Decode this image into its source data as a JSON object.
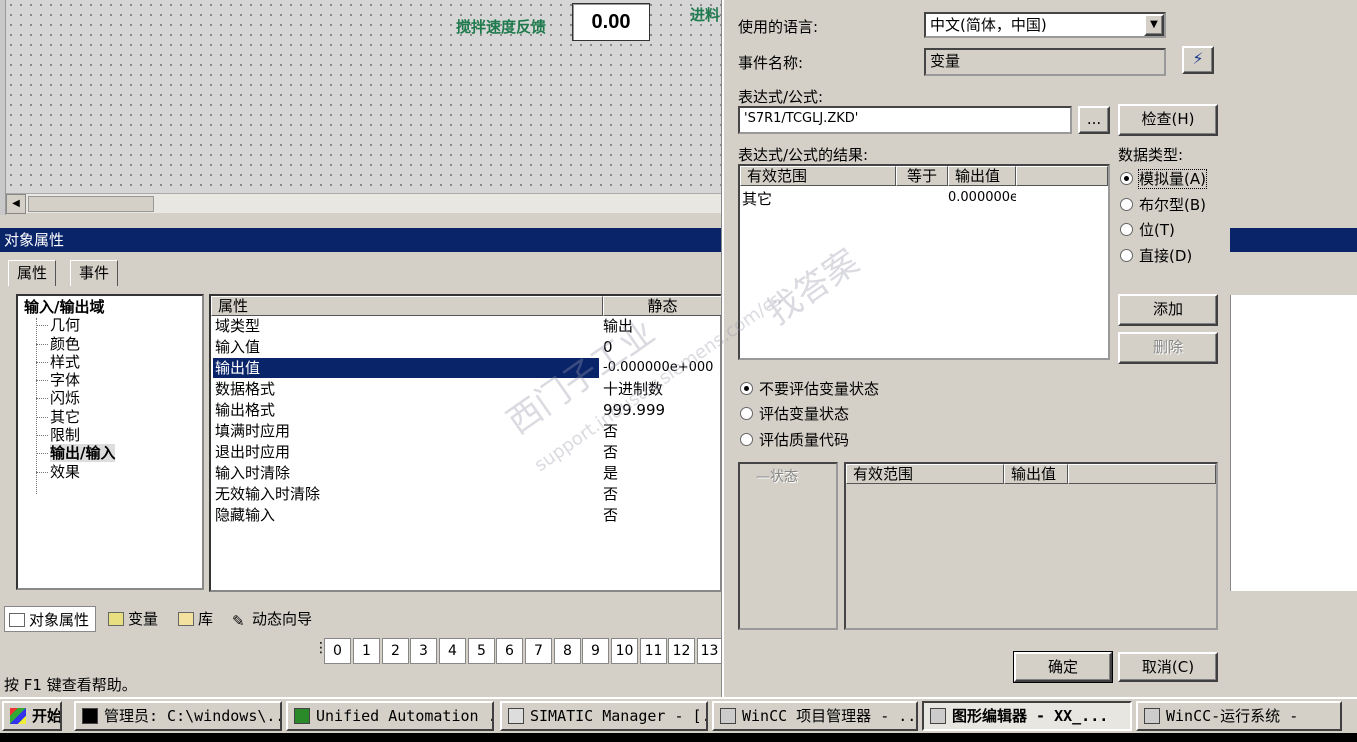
{
  "canvas": {
    "label_stir": "搅拌速度反馈",
    "field_value": "0.00",
    "label_feed": "进料"
  },
  "object_properties": {
    "title": "对象属性",
    "tabs": [
      "属性",
      "事件"
    ],
    "tree": {
      "root": "输入/输出域",
      "children": [
        "几何",
        "颜色",
        "样式",
        "字体",
        "闪烁",
        "其它",
        "限制",
        "输出/输入",
        "效果"
      ]
    },
    "table": {
      "col_property": "属性",
      "col_static": "静态",
      "rows": [
        {
          "name": "域类型",
          "value": "输出"
        },
        {
          "name": "输入值",
          "value": "0"
        },
        {
          "name": "输出值",
          "value": "-0.000000e+000"
        },
        {
          "name": "数据格式",
          "value": "十进制数"
        },
        {
          "name": "输出格式",
          "value": "999.999"
        },
        {
          "name": "填满时应用",
          "value": "否"
        },
        {
          "name": "退出时应用",
          "value": "否"
        },
        {
          "name": "输入时清除",
          "value": "是"
        },
        {
          "name": "无效输入时清除",
          "value": "否"
        },
        {
          "name": "隐藏输入",
          "value": "否"
        }
      ]
    }
  },
  "bottom_tabs": [
    "对象属性",
    "变量",
    "库",
    "动态向导"
  ],
  "layers": [
    "0",
    "1",
    "2",
    "3",
    "4",
    "5",
    "6",
    "7",
    "8",
    "9",
    "10",
    "11",
    "12",
    "13"
  ],
  "status_text": "按 F1 键查看帮助。",
  "dialog": {
    "language_label": "使用的语言:",
    "language_value": "中文(简体，中国)",
    "event_label": "事件名称:",
    "event_value": "变量",
    "expr_label": "表达式/公式:",
    "expr_value": "'S7R1/TCGLJ.ZKD'",
    "browse_button": "...",
    "check_button": "检查(H)",
    "result_label": "表达式/公式的结果:",
    "result_cols": [
      "有效范围",
      "等于",
      "输出值"
    ],
    "result_row": {
      "range": "其它",
      "value": "0.000000e"
    },
    "datatype_label": "数据类型:",
    "datatype_options": [
      "模拟量(A)",
      "布尔型(B)",
      "位(T)",
      "直接(D)"
    ],
    "add_button": "添加",
    "delete_button": "删除",
    "eval_options": [
      "不要评估变量状态",
      "评估变量状态",
      "评估质量代码"
    ],
    "status_col": "状态",
    "status_cols": [
      "有效范围",
      "输出值"
    ],
    "ok_button": "确定",
    "cancel_button": "取消(C)"
  },
  "taskbar": {
    "start": "开始",
    "items": [
      "管理员: C:\\windows\\...",
      "Unified Automation ...",
      "SIMATIC Manager - [...",
      "WinCC 项目管理器 - ...",
      "图形编辑器 - XX_...",
      "WinCC-运行系统 -"
    ]
  },
  "watermark": {
    "line1": "西门子工业",
    "line2": "support.industry.siemens.com/cs",
    "line3": "找答案"
  }
}
